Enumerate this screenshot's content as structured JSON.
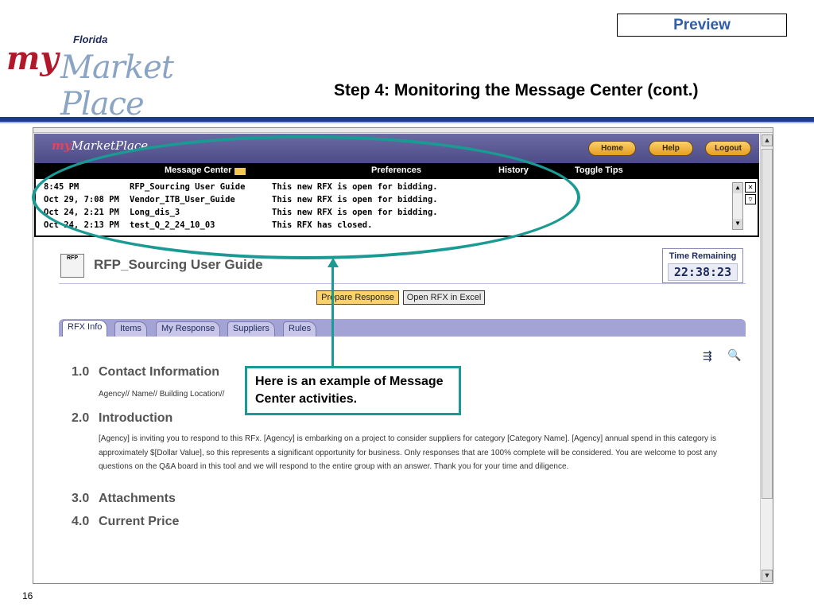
{
  "slide": {
    "preview_label": "Preview",
    "title": "Step 4: Monitoring the Message Center (cont.)",
    "logo": {
      "my": "my",
      "florida": "Florida",
      "market_place": "Market Place"
    },
    "number": "16"
  },
  "app": {
    "mini_logo": {
      "my": "my",
      "rest": "MarketPlace"
    },
    "header_buttons": {
      "home": "Home",
      "help": "Help",
      "logout": "Logout"
    },
    "nav": {
      "message_center": "Message Center",
      "preferences": "Preferences",
      "history": "History",
      "toggle_tips": "Toggle Tips"
    },
    "messages": [
      {
        "time": "8:45 PM",
        "name": "RFP_Sourcing User Guide",
        "status": "This new RFX is open for bidding."
      },
      {
        "time": "Oct 29, 7:08 PM",
        "name": "Vendor_ITB_User_Guide",
        "status": "This new RFX is open for bidding."
      },
      {
        "time": "Oct 24, 2:21 PM",
        "name": "Long_dis_3",
        "status": "This new RFX is open for bidding."
      },
      {
        "time": "Oct 24, 2:13 PM",
        "name": "test_Q_2_24_10_03",
        "status": "This RFX has closed."
      }
    ],
    "rfx": {
      "icon_label": "RFP",
      "title": "RFP_Sourcing User Guide",
      "time_remaining_label": "Time Remaining",
      "time_remaining": "22:38:23",
      "buttons": {
        "prepare": "Prepare Response",
        "excel": "Open RFX in Excel"
      },
      "tabs": [
        "RFX Info",
        "Items",
        "My Response",
        "Suppliers",
        "Rules"
      ],
      "sections": [
        {
          "num": "1.0",
          "title": "Contact Information",
          "text": "Agency// Name// Building Location//"
        },
        {
          "num": "2.0",
          "title": "Introduction",
          "text": "[Agency] is inviting you to respond to this RFx. [Agency] is embarking on a project to consider suppliers for category [Category Name]. [Agency] annual spend in this category is approximately $[Dollar Value], so this represents a significant opportunity for business. Only responses that are 100% complete will be considered. You are welcome to post any questions on the Q&A board in this tool and we will respond to the entire group with an answer. Thank you for your time and diligence."
        },
        {
          "num": "3.0",
          "title": "Attachments"
        },
        {
          "num": "4.0",
          "title": "Current Price"
        }
      ]
    }
  },
  "callout": {
    "text": "Here is an example of Message Center activities."
  },
  "colors": {
    "accent_teal": "#1a9a93",
    "title_blue": "#2f5da8",
    "header_purple": "#5b5a96"
  }
}
